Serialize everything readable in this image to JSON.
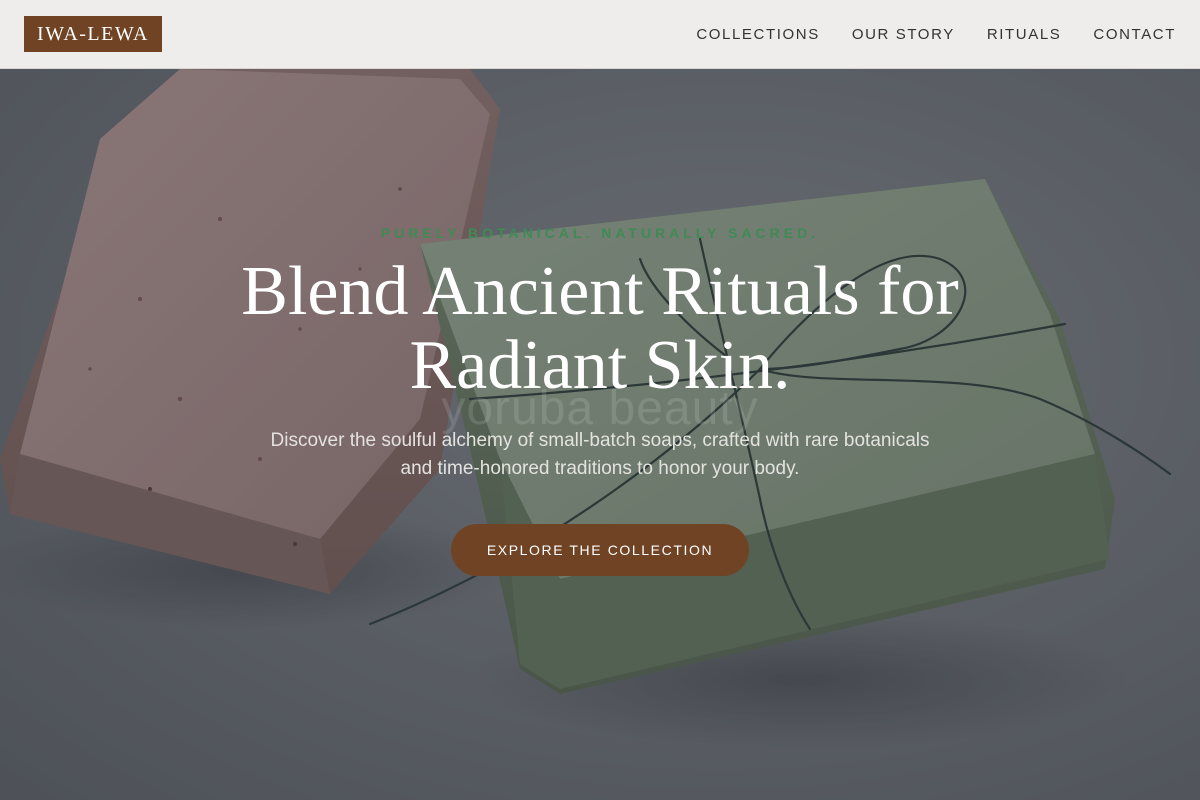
{
  "header": {
    "logo": "IWA-LEWA",
    "nav": [
      {
        "label": "COLLECTIONS"
      },
      {
        "label": "OUR STORY"
      },
      {
        "label": "RITUALS"
      },
      {
        "label": "CONTACT"
      }
    ]
  },
  "hero": {
    "eyebrow": "PURELY BOTANICAL. NATURALLY SACRED.",
    "headline": "Blend Ancient Rituals for Radiant Skin.",
    "watermark": "yoruba beauty",
    "subtext": "Discover the soulful alchemy of small-batch soaps, crafted with rare botanicals and time-honored traditions to honor your body.",
    "cta_label": "EXPLORE THE COLLECTION",
    "image_subject": "two handmade soap bars, pink clay bar and green bar tied with twine"
  },
  "colors": {
    "brand_brown": "#6f4324",
    "eyebrow_green": "#3f8a55",
    "header_bg": "#efedeb",
    "nav_text": "#333333",
    "headline_text": "#ffffff"
  }
}
